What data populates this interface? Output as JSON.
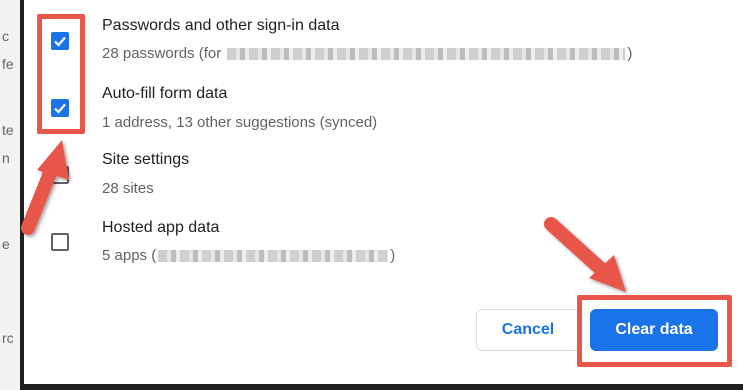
{
  "items": [
    {
      "title": "Passwords and other sign-in data",
      "subtitle_prefix": "28 passwords (for",
      "subtitle_suffix": ")",
      "checked": true
    },
    {
      "title": "Auto-fill form data",
      "subtitle": "1 address, 13 other suggestions (synced)",
      "checked": true
    },
    {
      "title": "Site settings",
      "subtitle": "28 sites",
      "checked": false
    },
    {
      "title": "Hosted app data",
      "subtitle_prefix": "5 apps (",
      "subtitle_suffix": ")",
      "checked": false
    }
  ],
  "buttons": {
    "cancel": "Cancel",
    "clear": "Clear data"
  },
  "background_fragments": [
    "c",
    "fe",
    "te",
    "n",
    "e",
    "rc"
  ],
  "colors": {
    "accent": "#1a73e8",
    "annotation": "#e8574a"
  },
  "icons": {
    "check": "check-icon",
    "arrow": "annotation-arrow"
  }
}
